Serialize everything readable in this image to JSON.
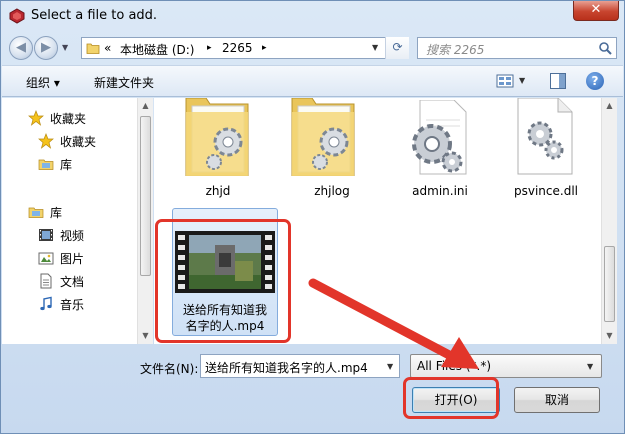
{
  "window": {
    "title": "Select a file to add.",
    "close_label": "✕"
  },
  "address_bar": {
    "prefix": "«",
    "segments": [
      "本地磁盘 (D:)",
      "2265"
    ],
    "separator": "▸"
  },
  "search": {
    "placeholder": "搜索 2265"
  },
  "toolbar": {
    "organize_label": "组织 ▾",
    "new_folder_label": "新建文件夹",
    "help_label": "?"
  },
  "nav_pane": {
    "items": [
      {
        "label": "收藏夹",
        "icon": "star-icon"
      },
      {
        "label": "收藏夹",
        "icon": "star-icon"
      },
      {
        "label": "库",
        "icon": "library-icon"
      },
      {
        "label": "库",
        "icon": "library-icon"
      },
      {
        "label": "视频",
        "icon": "video-icon"
      },
      {
        "label": "图片",
        "icon": "picture-icon"
      },
      {
        "label": "文档",
        "icon": "document-icon"
      },
      {
        "label": "音乐",
        "icon": "music-icon"
      }
    ]
  },
  "files": [
    {
      "name": "zhjd",
      "type": "folder-icon"
    },
    {
      "name": "zhjlog",
      "type": "folder-icon"
    },
    {
      "name": "admin.ini",
      "type": "config-file-icon"
    },
    {
      "name": "psvince.dll",
      "type": "dll-file-icon"
    },
    {
      "name": "送给所有知道我名字的人.mp4",
      "type": "video-thumbnail-icon",
      "label_line1": "送给所有知道我",
      "label_line2": "名字的人.mp4",
      "selected": true
    }
  ],
  "bottom": {
    "filename_label": "文件名(N):",
    "filename_value": "送给所有知道我名字的人.mp4",
    "filetype_value": "All Files (*.*)",
    "open_label": "打开(O)",
    "cancel_label": "取消"
  },
  "annotation_color": "#e2352a"
}
